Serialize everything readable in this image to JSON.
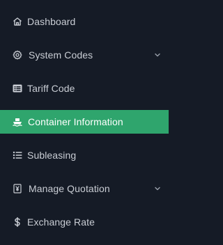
{
  "sidebar": {
    "items": [
      {
        "label": "Dashboard",
        "icon": "home-icon"
      },
      {
        "label": "System Codes",
        "icon": "gear-icon",
        "submenu_indicator": "chevron-down-icon"
      },
      {
        "label": "Tariff Code",
        "icon": "list-card-icon"
      },
      {
        "label": "Container Information",
        "icon": "ship-icon",
        "active": true
      },
      {
        "label": "Subleasing",
        "icon": "list-icon"
      },
      {
        "label": "Manage Quotation",
        "icon": "yen-document-icon",
        "submenu_indicator": "chevron-down-icon"
      },
      {
        "label": "Exchange Rate",
        "icon": "dollar-icon"
      }
    ]
  },
  "colors": {
    "background": "#151b26",
    "text": "#c9cdd4",
    "active_background": "#2fa56d",
    "active_text": "#ffffff"
  }
}
